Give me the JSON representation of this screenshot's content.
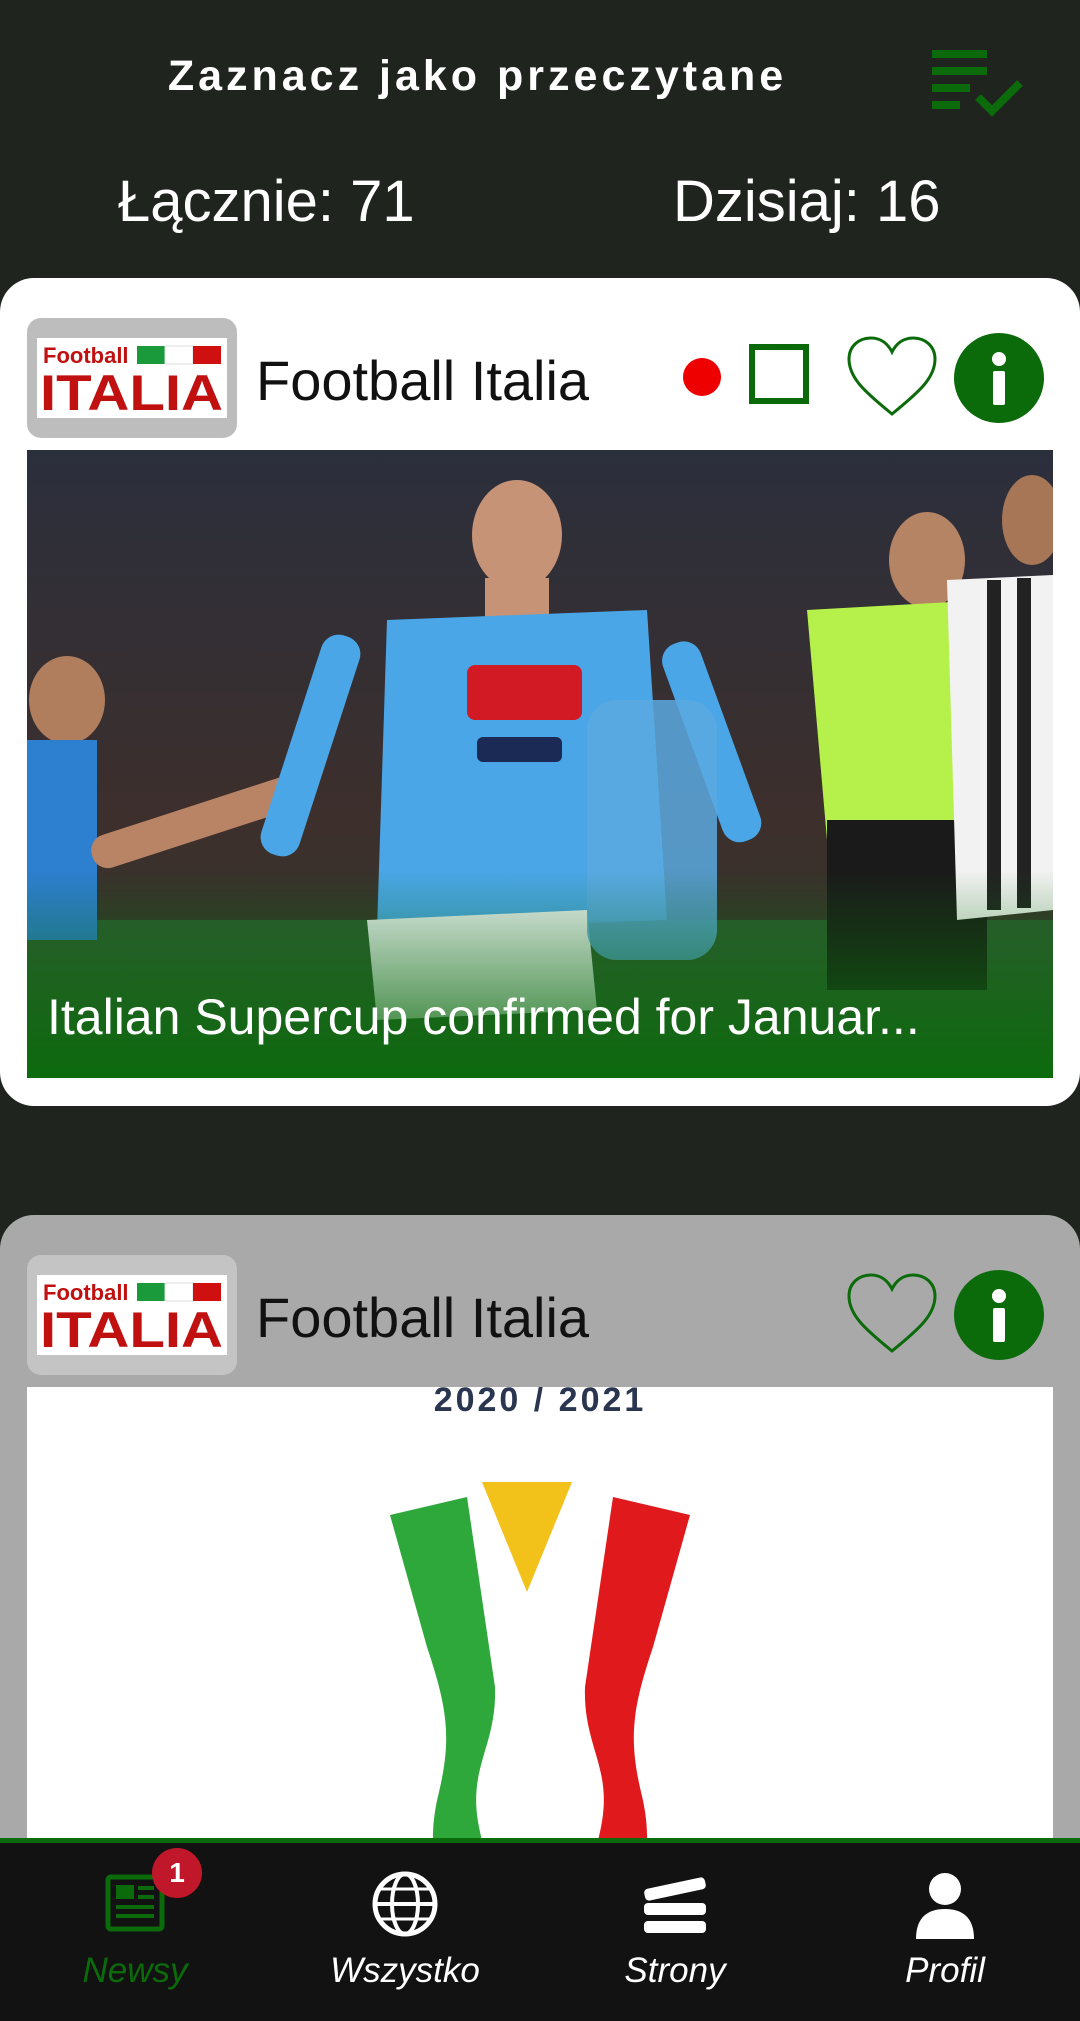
{
  "header": {
    "title": "Zaznacz jako przeczytane",
    "action_icon": "mark-all-read-icon",
    "accent_color": "#0b6b0b"
  },
  "counters": {
    "total": "Łącznie: 71",
    "today": "Dzisiaj: 16"
  },
  "cards": [
    {
      "source": "Football Italia",
      "logo_text_top": "Football",
      "logo_text_main": "ITALIA",
      "headline": "Italian Supercup confirmed for Januar...",
      "unread": true
    },
    {
      "source": "Football Italia",
      "logo_text_top": "Football",
      "logo_text_main": "ITALIA",
      "image_caption": "2020 / 2021",
      "unread": false
    }
  ],
  "nav": {
    "items": [
      {
        "label": "Newsy",
        "icon": "newspaper-icon",
        "badge": "1",
        "active": true
      },
      {
        "label": "Wszystko",
        "icon": "globe-icon",
        "active": false
      },
      {
        "label": "Strony",
        "icon": "stack-icon",
        "active": false
      },
      {
        "label": "Profil",
        "icon": "user-icon",
        "active": false
      }
    ]
  }
}
